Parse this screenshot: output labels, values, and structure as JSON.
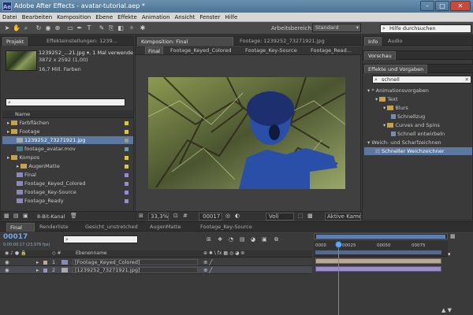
{
  "window": {
    "title": "Adobe After Effects - avatar-tutorial.aep *",
    "app_icon": "Ae"
  },
  "menu": [
    "Datei",
    "Bearbeiten",
    "Komposition",
    "Ebene",
    "Effekte",
    "Animation",
    "Ansicht",
    "Fenster",
    "Hilfe"
  ],
  "toolbar": {
    "workspace_label": "Arbeitsbereich:",
    "workspace_value": "Standard",
    "help_search_placeholder": "Hilfe durchsuchen"
  },
  "project": {
    "tabs": [
      "Projekt",
      "Effekteinstellungen: 1239..."
    ],
    "selected_name": "1239252_...21.jpg ▾",
    "usage": ", 1 Mal verwendet",
    "dimensions": "3872 x 2592 (1,00)",
    "colors": "16,7 Mill. Farben",
    "column_name": "Name",
    "items": [
      {
        "label": "Farbflächen",
        "type": "folder",
        "depth": 0,
        "swatch": "#d8c84a"
      },
      {
        "label": "Footage",
        "type": "folder",
        "depth": 0,
        "swatch": "#d8c84a"
      },
      {
        "label": "1239252_73271921.jpg",
        "type": "image",
        "depth": 1,
        "swatch": "#9a9a9a",
        "selected": true
      },
      {
        "label": "footage_avatar.mov",
        "type": "movie",
        "depth": 1,
        "swatch": "#5fa0b0"
      },
      {
        "label": "Kompos",
        "type": "folder",
        "depth": 0,
        "swatch": "#d8c84a"
      },
      {
        "label": "AugenMatte",
        "type": "folder",
        "depth": 1,
        "swatch": "#d8c84a"
      },
      {
        "label": "Final",
        "type": "comp",
        "depth": 1,
        "swatch": "#9a8ad0"
      },
      {
        "label": "Footage_Keyed_Colored",
        "type": "comp",
        "depth": 1,
        "swatch": "#9a8ad0"
      },
      {
        "label": "Footage_Key-Source",
        "type": "comp",
        "depth": 1,
        "swatch": "#9a8ad0"
      },
      {
        "label": "Footage_Ready",
        "type": "comp",
        "depth": 1,
        "swatch": "#9a8ad0"
      }
    ],
    "bit_depth": "8-Bit-Kanal"
  },
  "composition": {
    "tabs": [
      "Komposition: Final",
      "Footage: 1239252_73271921.jpg"
    ],
    "breadcrumbs": [
      "Final",
      "Footage_Keyed_Colored",
      "Footage_Key-Source",
      "Footage_Read..."
    ],
    "zoom": "33,3%",
    "timecode": "00017",
    "resolution": "Voll",
    "camera": "Aktive Kamer"
  },
  "right_panel": {
    "tabs": [
      "Info",
      "Audio"
    ],
    "preview_tab": "Vorschau",
    "effects_tab": "Effekte und Vorgaben",
    "search_value": "schnell",
    "tree": [
      {
        "label": "* Animationsvorgaben",
        "depth": 0
      },
      {
        "label": "Text",
        "depth": 1,
        "folder": true
      },
      {
        "label": "Blurs",
        "depth": 2,
        "folder": true
      },
      {
        "label": "Schnellzug",
        "depth": 3
      },
      {
        "label": "Curves and Spins",
        "depth": 2,
        "folder": true
      },
      {
        "label": "Schnell entwirbeln",
        "depth": 3
      },
      {
        "label": "Weich- und Scharfzeichnen",
        "depth": 0
      },
      {
        "label": "Schneller Weichzeichner",
        "depth": 1,
        "selected": true
      }
    ]
  },
  "timeline": {
    "tabs": [
      "Final",
      "Renderliste",
      "Gesicht_unstretched",
      "AugenMatte",
      "Footage_Key-Source"
    ],
    "timecode": "00017",
    "timecode_sub": "0:00:00:17 (23,976 fps)",
    "column_header": "Ebenenname",
    "ruler_labels": [
      "0000",
      "00025",
      "00050",
      "00075"
    ],
    "layers": [
      {
        "num": "1",
        "name": "[Footage_Keyed_Colored]"
      },
      {
        "num": "2",
        "name": "[1239252_73271921.jpg]"
      }
    ]
  },
  "colors": {
    "accent_blue": "#5b78a0",
    "timecode_blue": "#6fa8e8",
    "playhead": "#ff5a2a",
    "label_yellow": "#d8c84a",
    "label_lavender": "#9a8ad0"
  }
}
